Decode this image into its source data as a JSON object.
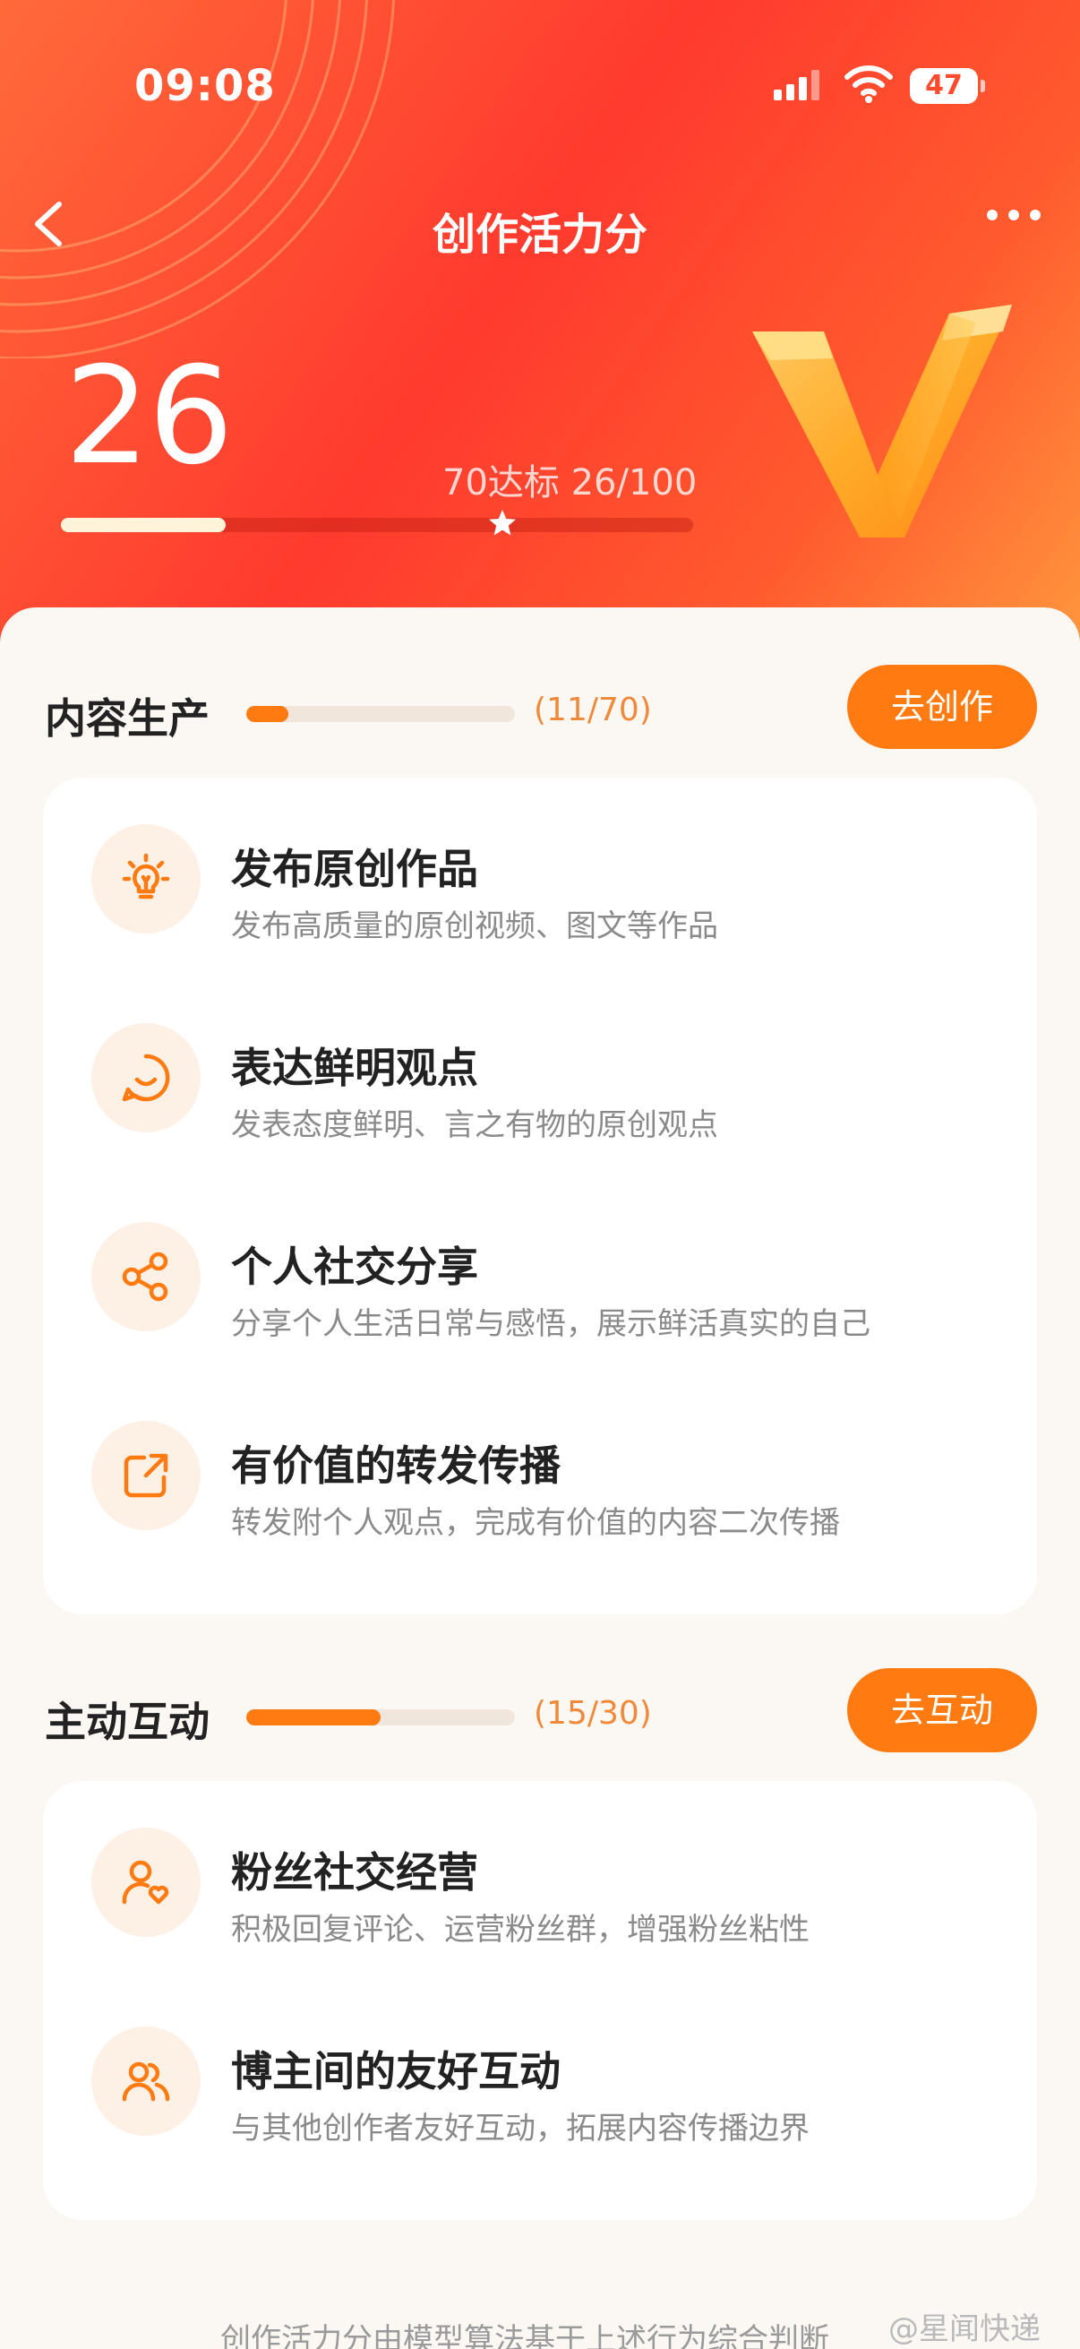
{
  "status_bar": {
    "time": "09:08",
    "battery": "47"
  },
  "nav": {
    "title": "创作活力分"
  },
  "hero": {
    "score": "26",
    "target_text": "70达标 26/100",
    "progress_percent": 26,
    "target_percent": 70
  },
  "sections": [
    {
      "title": "内容生产",
      "count": "(11/70)",
      "progress_fraction": 0.157,
      "button": "去创作",
      "items": [
        {
          "icon": "lightbulb-icon",
          "title": "发布原创作品",
          "subtitle": "发布高质量的原创视频、图文等作品"
        },
        {
          "icon": "smile-chat-icon",
          "title": "表达鲜明观点",
          "subtitle": "发表态度鲜明、言之有物的原创观点"
        },
        {
          "icon": "share-icon",
          "title": "个人社交分享",
          "subtitle": "分享个人生活日常与感悟，展示鲜活真实的自己"
        },
        {
          "icon": "repost-icon",
          "title": "有价值的转发传播",
          "subtitle": "转发附个人观点，完成有价值的内容二次传播"
        }
      ]
    },
    {
      "title": "主动互动",
      "count": "(15/30)",
      "progress_fraction": 0.5,
      "button": "去互动",
      "items": [
        {
          "icon": "fan-heart-icon",
          "title": "粉丝社交经营",
          "subtitle": "积极回复评论、运营粉丝群，增强粉丝粘性"
        },
        {
          "icon": "people-icon",
          "title": "博主间的友好互动",
          "subtitle": "与其他创作者友好互动，拓展内容传播边界"
        }
      ]
    }
  ],
  "footer": {
    "note": "创作活力分由模型算法基于上述行为综合判断",
    "watermark": "@星闻快递"
  },
  "colors": {
    "accent": "#ff7a10",
    "header_red": "#ff3a2e",
    "text_gray": "#8a8a8a"
  }
}
